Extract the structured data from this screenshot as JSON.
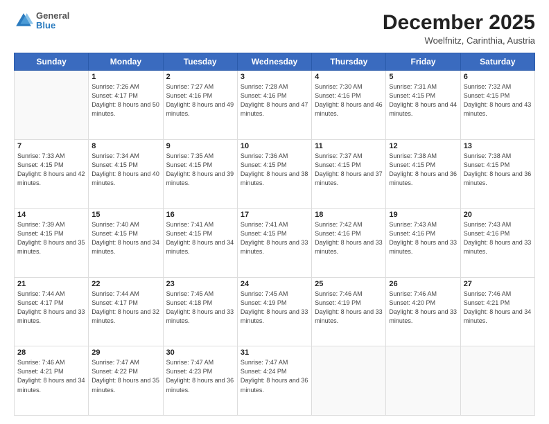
{
  "logo": {
    "line1": "General",
    "line2": "Blue"
  },
  "title": "December 2025",
  "location": "Woelfnitz, Carinthia, Austria",
  "days_header": [
    "Sunday",
    "Monday",
    "Tuesday",
    "Wednesday",
    "Thursday",
    "Friday",
    "Saturday"
  ],
  "weeks": [
    [
      {
        "day": "",
        "sunrise": "",
        "sunset": "",
        "daylight": ""
      },
      {
        "day": "1",
        "sunrise": "Sunrise: 7:26 AM",
        "sunset": "Sunset: 4:17 PM",
        "daylight": "Daylight: 8 hours and 50 minutes."
      },
      {
        "day": "2",
        "sunrise": "Sunrise: 7:27 AM",
        "sunset": "Sunset: 4:16 PM",
        "daylight": "Daylight: 8 hours and 49 minutes."
      },
      {
        "day": "3",
        "sunrise": "Sunrise: 7:28 AM",
        "sunset": "Sunset: 4:16 PM",
        "daylight": "Daylight: 8 hours and 47 minutes."
      },
      {
        "day": "4",
        "sunrise": "Sunrise: 7:30 AM",
        "sunset": "Sunset: 4:16 PM",
        "daylight": "Daylight: 8 hours and 46 minutes."
      },
      {
        "day": "5",
        "sunrise": "Sunrise: 7:31 AM",
        "sunset": "Sunset: 4:15 PM",
        "daylight": "Daylight: 8 hours and 44 minutes."
      },
      {
        "day": "6",
        "sunrise": "Sunrise: 7:32 AM",
        "sunset": "Sunset: 4:15 PM",
        "daylight": "Daylight: 8 hours and 43 minutes."
      }
    ],
    [
      {
        "day": "7",
        "sunrise": "Sunrise: 7:33 AM",
        "sunset": "Sunset: 4:15 PM",
        "daylight": "Daylight: 8 hours and 42 minutes."
      },
      {
        "day": "8",
        "sunrise": "Sunrise: 7:34 AM",
        "sunset": "Sunset: 4:15 PM",
        "daylight": "Daylight: 8 hours and 40 minutes."
      },
      {
        "day": "9",
        "sunrise": "Sunrise: 7:35 AM",
        "sunset": "Sunset: 4:15 PM",
        "daylight": "Daylight: 8 hours and 39 minutes."
      },
      {
        "day": "10",
        "sunrise": "Sunrise: 7:36 AM",
        "sunset": "Sunset: 4:15 PM",
        "daylight": "Daylight: 8 hours and 38 minutes."
      },
      {
        "day": "11",
        "sunrise": "Sunrise: 7:37 AM",
        "sunset": "Sunset: 4:15 PM",
        "daylight": "Daylight: 8 hours and 37 minutes."
      },
      {
        "day": "12",
        "sunrise": "Sunrise: 7:38 AM",
        "sunset": "Sunset: 4:15 PM",
        "daylight": "Daylight: 8 hours and 36 minutes."
      },
      {
        "day": "13",
        "sunrise": "Sunrise: 7:38 AM",
        "sunset": "Sunset: 4:15 PM",
        "daylight": "Daylight: 8 hours and 36 minutes."
      }
    ],
    [
      {
        "day": "14",
        "sunrise": "Sunrise: 7:39 AM",
        "sunset": "Sunset: 4:15 PM",
        "daylight": "Daylight: 8 hours and 35 minutes."
      },
      {
        "day": "15",
        "sunrise": "Sunrise: 7:40 AM",
        "sunset": "Sunset: 4:15 PM",
        "daylight": "Daylight: 8 hours and 34 minutes."
      },
      {
        "day": "16",
        "sunrise": "Sunrise: 7:41 AM",
        "sunset": "Sunset: 4:15 PM",
        "daylight": "Daylight: 8 hours and 34 minutes."
      },
      {
        "day": "17",
        "sunrise": "Sunrise: 7:41 AM",
        "sunset": "Sunset: 4:15 PM",
        "daylight": "Daylight: 8 hours and 33 minutes."
      },
      {
        "day": "18",
        "sunrise": "Sunrise: 7:42 AM",
        "sunset": "Sunset: 4:16 PM",
        "daylight": "Daylight: 8 hours and 33 minutes."
      },
      {
        "day": "19",
        "sunrise": "Sunrise: 7:43 AM",
        "sunset": "Sunset: 4:16 PM",
        "daylight": "Daylight: 8 hours and 33 minutes."
      },
      {
        "day": "20",
        "sunrise": "Sunrise: 7:43 AM",
        "sunset": "Sunset: 4:16 PM",
        "daylight": "Daylight: 8 hours and 33 minutes."
      }
    ],
    [
      {
        "day": "21",
        "sunrise": "Sunrise: 7:44 AM",
        "sunset": "Sunset: 4:17 PM",
        "daylight": "Daylight: 8 hours and 33 minutes."
      },
      {
        "day": "22",
        "sunrise": "Sunrise: 7:44 AM",
        "sunset": "Sunset: 4:17 PM",
        "daylight": "Daylight: 8 hours and 32 minutes."
      },
      {
        "day": "23",
        "sunrise": "Sunrise: 7:45 AM",
        "sunset": "Sunset: 4:18 PM",
        "daylight": "Daylight: 8 hours and 33 minutes."
      },
      {
        "day": "24",
        "sunrise": "Sunrise: 7:45 AM",
        "sunset": "Sunset: 4:19 PM",
        "daylight": "Daylight: 8 hours and 33 minutes."
      },
      {
        "day": "25",
        "sunrise": "Sunrise: 7:46 AM",
        "sunset": "Sunset: 4:19 PM",
        "daylight": "Daylight: 8 hours and 33 minutes."
      },
      {
        "day": "26",
        "sunrise": "Sunrise: 7:46 AM",
        "sunset": "Sunset: 4:20 PM",
        "daylight": "Daylight: 8 hours and 33 minutes."
      },
      {
        "day": "27",
        "sunrise": "Sunrise: 7:46 AM",
        "sunset": "Sunset: 4:21 PM",
        "daylight": "Daylight: 8 hours and 34 minutes."
      }
    ],
    [
      {
        "day": "28",
        "sunrise": "Sunrise: 7:46 AM",
        "sunset": "Sunset: 4:21 PM",
        "daylight": "Daylight: 8 hours and 34 minutes."
      },
      {
        "day": "29",
        "sunrise": "Sunrise: 7:47 AM",
        "sunset": "Sunset: 4:22 PM",
        "daylight": "Daylight: 8 hours and 35 minutes."
      },
      {
        "day": "30",
        "sunrise": "Sunrise: 7:47 AM",
        "sunset": "Sunset: 4:23 PM",
        "daylight": "Daylight: 8 hours and 36 minutes."
      },
      {
        "day": "31",
        "sunrise": "Sunrise: 7:47 AM",
        "sunset": "Sunset: 4:24 PM",
        "daylight": "Daylight: 8 hours and 36 minutes."
      },
      {
        "day": "",
        "sunrise": "",
        "sunset": "",
        "daylight": ""
      },
      {
        "day": "",
        "sunrise": "",
        "sunset": "",
        "daylight": ""
      },
      {
        "day": "",
        "sunrise": "",
        "sunset": "",
        "daylight": ""
      }
    ]
  ]
}
